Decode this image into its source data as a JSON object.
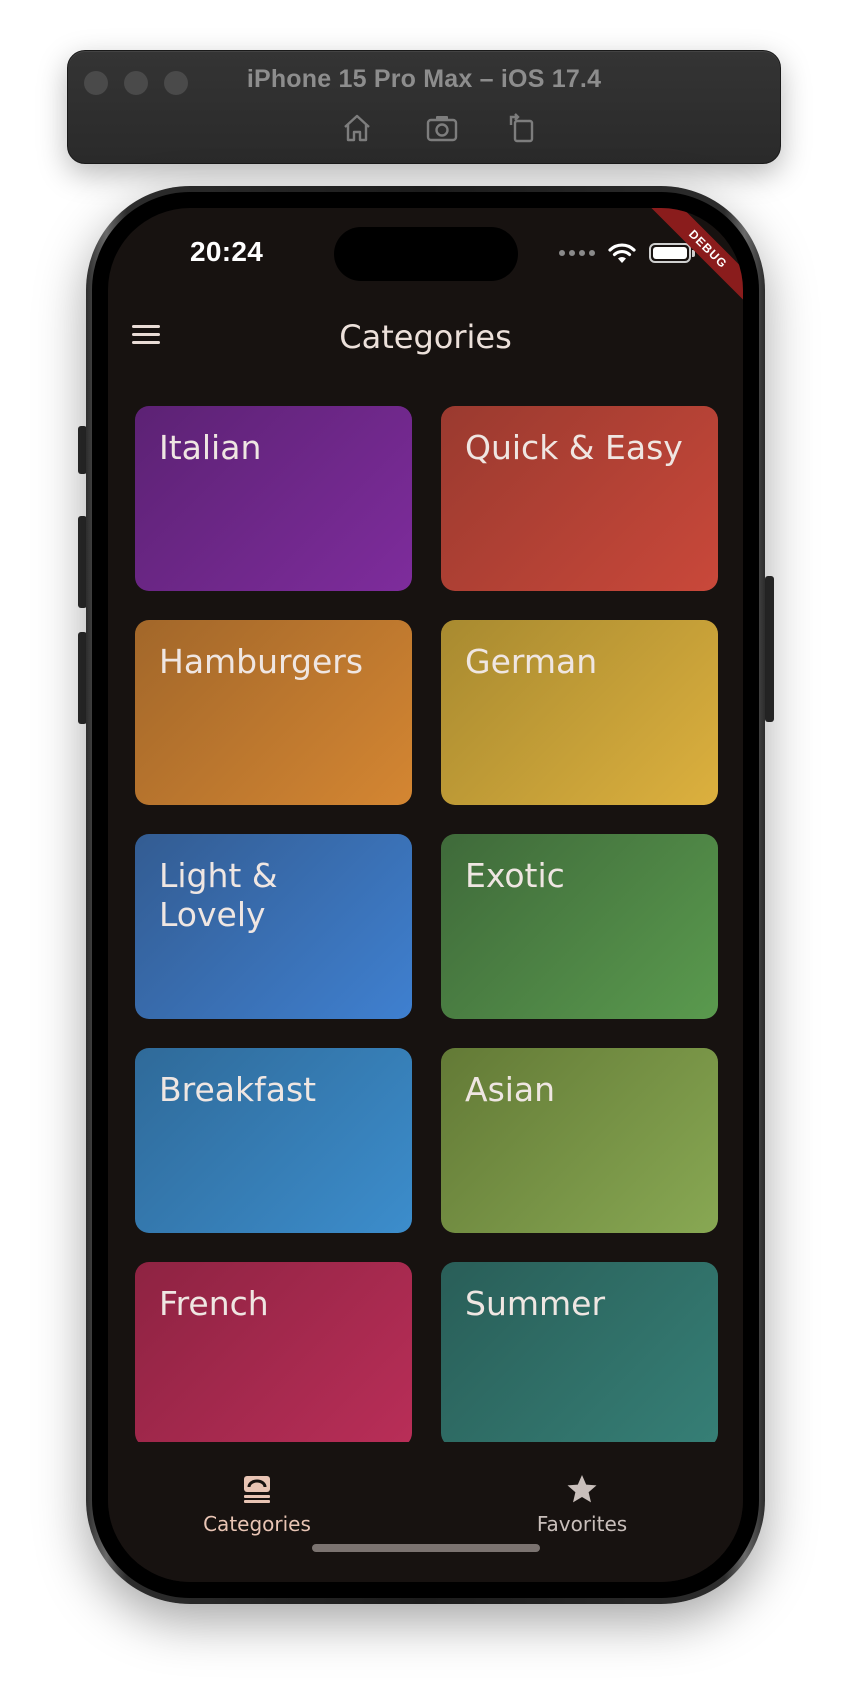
{
  "simulator": {
    "title": "iPhone 15 Pro Max – iOS 17.4",
    "buttons": [
      "home-icon",
      "screenshot-icon",
      "rotate-icon"
    ]
  },
  "status_bar": {
    "time": "20:24",
    "debug_label": "DEBUG"
  },
  "app_bar": {
    "title": "Categories",
    "menu_icon": "menu-icon"
  },
  "categories": [
    {
      "title": "Italian",
      "color_start": "#5c2274",
      "color_end": "#7e2c9c"
    },
    {
      "title": "Quick & Easy",
      "color_start": "#9a3a2f",
      "color_end": "#c9483a"
    },
    {
      "title": "Hamburgers",
      "color_start": "#a2672a",
      "color_end": "#d48632"
    },
    {
      "title": "German",
      "color_start": "#a88a30",
      "color_end": "#dcb03e"
    },
    {
      "title": "Light & Lovely",
      "color_start": "#335c92",
      "color_end": "#3f80d0"
    },
    {
      "title": "Exotic",
      "color_start": "#3f6a3a",
      "color_end": "#5a9a4e"
    },
    {
      "title": "Breakfast",
      "color_start": "#2f6a99",
      "color_end": "#3c8dcc"
    },
    {
      "title": "Asian",
      "color_start": "#637a36",
      "color_end": "#88a853"
    },
    {
      "title": "French",
      "color_start": "#8e2342",
      "color_end": "#b92e58"
    },
    {
      "title": "Summer",
      "color_start": "#295e58",
      "color_end": "#367f76"
    }
  ],
  "bottom_nav": {
    "items": [
      {
        "label": "Categories",
        "icon": "dish-icon",
        "active": true,
        "color": "#e8c4b4"
      },
      {
        "label": "Favorites",
        "icon": "star-icon",
        "active": false,
        "color": "#c9bfbb"
      }
    ]
  }
}
